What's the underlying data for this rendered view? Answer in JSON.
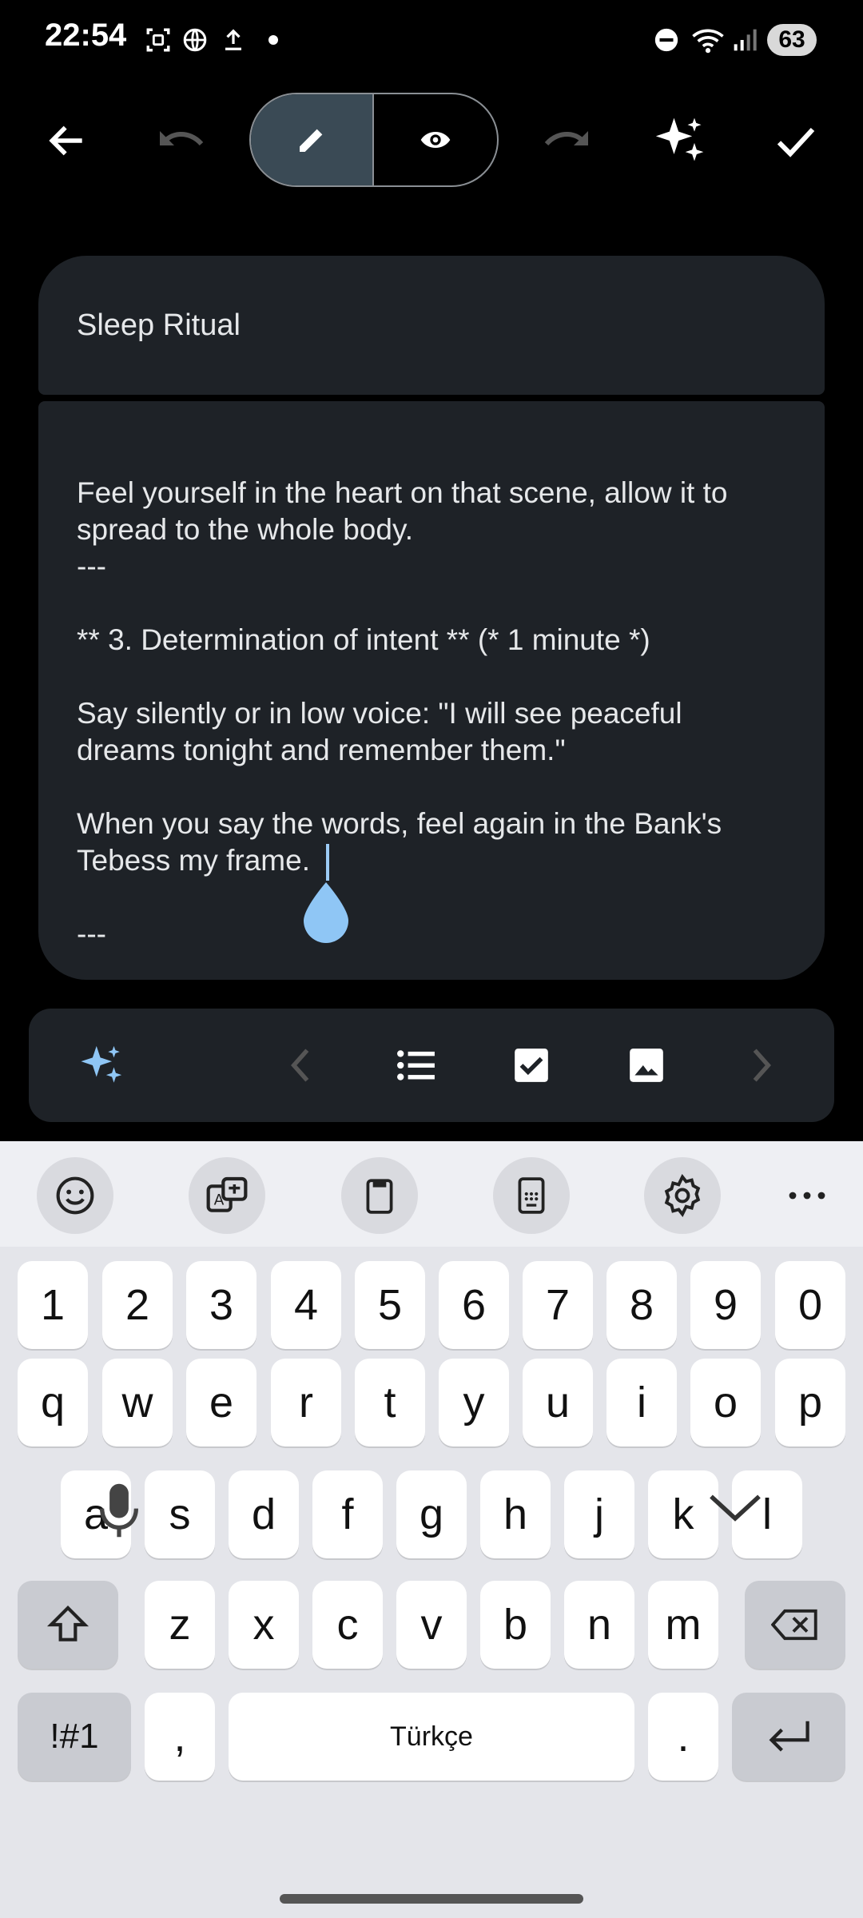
{
  "status_bar": {
    "time": "22:54",
    "battery": "63",
    "icons": [
      "screenshot-icon",
      "globe-icon",
      "upload-icon",
      "dot-icon",
      "dnd-icon",
      "wifi-icon",
      "signal-icon"
    ]
  },
  "toolbar": {
    "back": "back-arrow-icon",
    "undo": "undo-icon",
    "edit_mode": "pencil-icon",
    "preview_mode": "eye-icon",
    "redo": "redo-icon",
    "ai": "sparkle-icon",
    "done": "check-icon"
  },
  "note": {
    "title": "Sleep Ritual",
    "lines": [
      "Feel yourself in the heart on that scene, allow it to",
      "spread to the whole body.",
      "---",
      "",
      "** 3. Determination of intent ** (* 1 minute *)",
      "",
      "Say silently or in low voice: \"I will see peaceful",
      "dreams tonight and remember them.\"",
      "",
      "When you say the words, feel again in the Bank's",
      "Tebess my frame.",
      "",
      "---"
    ]
  },
  "format_bar": {
    "icons": [
      "sparkle-icon",
      "chevron-left-icon",
      "bulleted-list-icon",
      "checkbox-icon",
      "image-icon",
      "chevron-right-icon"
    ]
  },
  "keyboard": {
    "toolbar": [
      "emoji-icon",
      "translate-icon",
      "clipboard-icon",
      "keypad-icon",
      "settings-icon",
      "more-icon"
    ],
    "row_numbers": [
      "1",
      "2",
      "3",
      "4",
      "5",
      "6",
      "7",
      "8",
      "9",
      "0"
    ],
    "row1": [
      "q",
      "w",
      "e",
      "r",
      "t",
      "y",
      "u",
      "i",
      "o",
      "p"
    ],
    "row2": [
      "a",
      "s",
      "d",
      "f",
      "g",
      "h",
      "j",
      "k",
      "l"
    ],
    "row3": [
      "z",
      "x",
      "c",
      "v",
      "b",
      "n",
      "m"
    ],
    "symbols_label": "!#1",
    "comma": ",",
    "space_label": "Türkçe",
    "period": "."
  },
  "colors": {
    "background": "#000000",
    "card": "#1e2227",
    "accent_blue": "#8fc6f5",
    "keyboard_bg": "#e4e5ea"
  }
}
